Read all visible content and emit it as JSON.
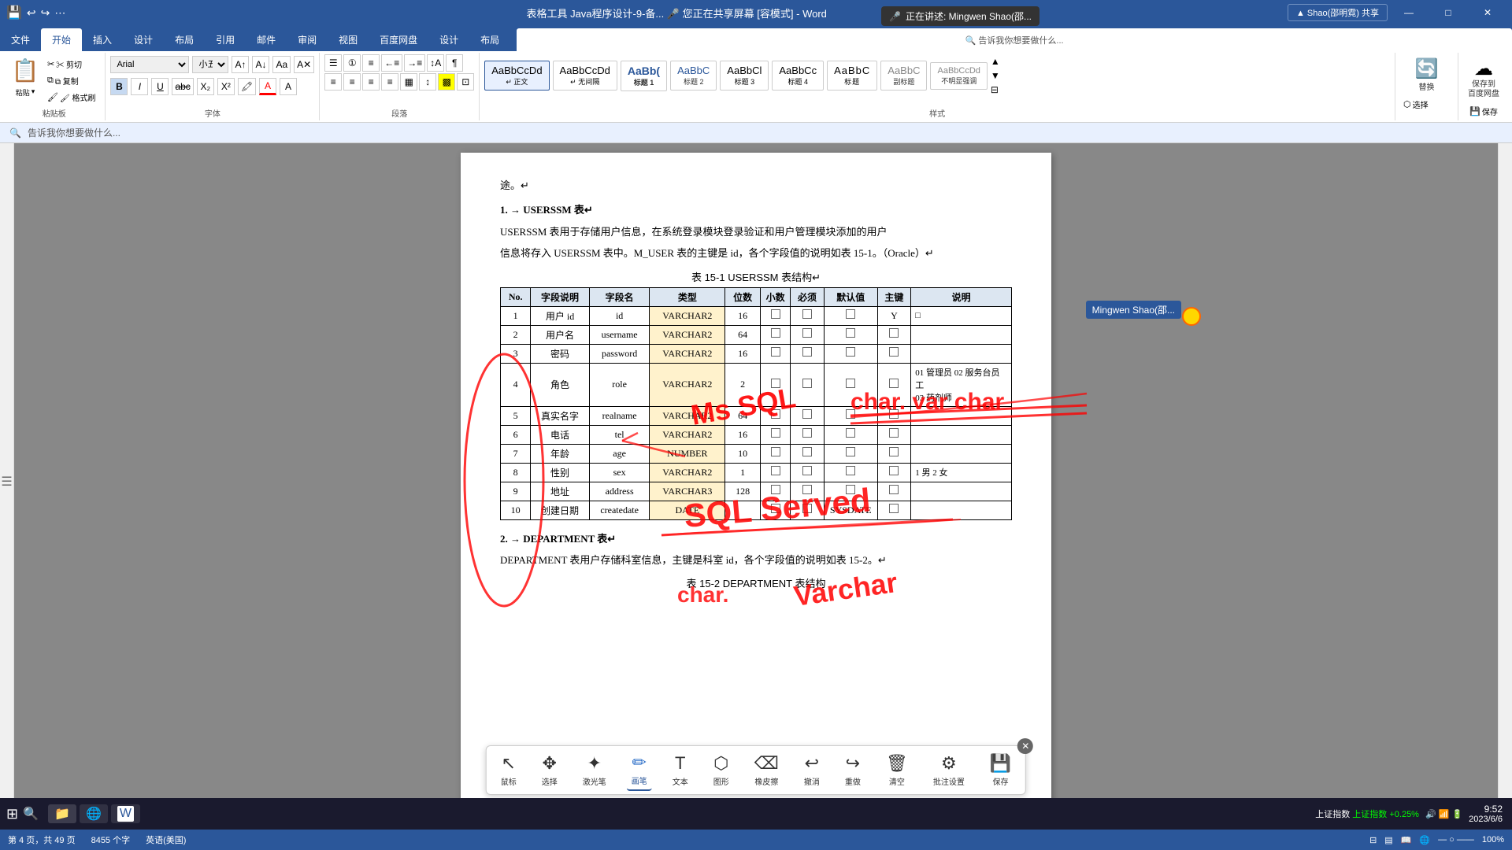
{
  "titlebar": {
    "left_icons": [
      "💾",
      "↩",
      "↪",
      "⋯"
    ],
    "center": "表格工具    Java程序设计-9-备...    🎤 您正在共享屏幕    [容模式] - Word",
    "right": "▲ Shao(邵明霓)   共享",
    "min": "—",
    "max": "□",
    "close": "✕"
  },
  "ribbon": {
    "tabs": [
      "文件",
      "开始",
      "插入",
      "设计",
      "布局",
      "引用",
      "邮件",
      "审阅",
      "视图",
      "百度网盘",
      "设计",
      "布局"
    ],
    "active_tab": "开始",
    "tell_me": "告诉我你想要做什么...",
    "clipboard": {
      "paste_label": "粘贴",
      "cut": "✂ 剪切",
      "copy": "⧉ 复制",
      "format_copy": "🖌 格式刷"
    },
    "font": {
      "face": "Arial",
      "size": "小五",
      "bold": "B",
      "italic": "I",
      "underline": "U",
      "strikethrough": "abc",
      "subscript": "X₂",
      "superscript": "X²"
    },
    "paragraph_label": "段落",
    "font_label": "字体",
    "styles_label": "样式",
    "styles": [
      {
        "label": "AaBbCcDd",
        "name": "正文",
        "active": true
      },
      {
        "label": "AaBbCcDd",
        "name": "无间隔"
      },
      {
        "label": "AaBb(",
        "name": "标题 1"
      },
      {
        "label": "AaBbC",
        "name": "标题 2"
      },
      {
        "label": "AaBbCl",
        "name": "标题 3"
      },
      {
        "label": "AaBbCc",
        "name": "标题 4"
      },
      {
        "label": "AaBbC",
        "name": "标题"
      },
      {
        "label": "AaBbC",
        "name": "副标题"
      },
      {
        "label": "AaBbCcDd",
        "name": "不明显强调"
      },
      {
        "label": "AaBbCcDd",
        "name": ""
      }
    ],
    "editing": {
      "replace": "替换",
      "select": "选择"
    },
    "save": {
      "label": "保存到\n百度网盘",
      "label2": "保存"
    }
  },
  "recording": {
    "text": "正在讲述: Mingwen Shao(邵..."
  },
  "document": {
    "path_note": "途。↵",
    "section1_num": "1.",
    "section1_title": "→ USERSSM 表↵",
    "para1": "USERSSM 表用于存储用户信息，在系统登录模块登录验证和用户管理模块添加的用户",
    "para2": "信息将存入 USERSSM 表中。M_USER 表的主键是 id，各个字段值的说明如表 15-1。（Oracle）↵",
    "table_title": "表 15-1 USERSSM 表结构↵",
    "table": {
      "headers": [
        "No.",
        "字段说明",
        "字段名",
        "类型",
        "位数",
        "小数",
        "必须",
        "默认值",
        "主键",
        "说明"
      ],
      "rows": [
        {
          "no": "1",
          "desc": "用户 id",
          "name": "id",
          "type": "VARCHAR2",
          "len": "16",
          "dec": "□",
          "req": "□",
          "def": "□",
          "pk": "Y",
          "note": "□"
        },
        {
          "no": "2",
          "desc": "用户名",
          "name": "username",
          "type": "VARCHAR2",
          "len": "64",
          "dec": "□□",
          "req": "□",
          "def": "□",
          "pk": "□",
          "note": ""
        },
        {
          "no": "3",
          "desc": "密码",
          "name": "password",
          "type": "VARCHAR2",
          "len": "16",
          "dec": "□□",
          "req": "□",
          "def": "□",
          "pk": "□",
          "note": ""
        },
        {
          "no": "4",
          "desc": "角色",
          "name": "role",
          "type": "VARCHAR2",
          "len": "2",
          "dec": "□□",
          "req": "□",
          "def": "□",
          "pk": "□",
          "note": "01 管理员 02 服务台员工\n03 药剂师"
        },
        {
          "no": "5",
          "desc": "真实名字",
          "name": "realname",
          "type": "VARCHAR2",
          "len": "64",
          "dec": "□□",
          "req": "□",
          "def": "□",
          "pk": "□",
          "note": ""
        },
        {
          "no": "6",
          "desc": "电话",
          "name": "tel",
          "type": "VARCHAR2",
          "len": "16",
          "dec": "□□",
          "req": "□",
          "def": "□",
          "pk": "□",
          "note": ""
        },
        {
          "no": "7",
          "desc": "年龄",
          "name": "age",
          "type": "NUMBER",
          "len": "10",
          "dec": "□□",
          "req": "□",
          "def": "□",
          "pk": "□",
          "note": ""
        },
        {
          "no": "8",
          "desc": "性别",
          "name": "sex",
          "type": "VARCHAR2",
          "len": "1",
          "dec": "□□",
          "req": "□",
          "def": "□",
          "pk": "□",
          "note": "1 男 2 女"
        },
        {
          "no": "9",
          "desc": "地址",
          "name": "address",
          "type": "VARCHAR3",
          "len": "128",
          "dec": "□□",
          "req": "□",
          "def": "□",
          "pk": "□",
          "note": ""
        },
        {
          "no": "10",
          "desc": "创建日期",
          "name": "createdate",
          "type": "DATE",
          "len": "",
          "dec": "□□",
          "req": "□",
          "def": "SYSDATE",
          "pk": "□",
          "note": ""
        }
      ]
    },
    "section2_num": "2.",
    "section2_title": "→ DEPARTMENT 表↵",
    "para3": "DEPARTMENT 表用户存储科室信息，主键是科室 id，各个字段值的说明如表 15-2。↵",
    "table2_title": "表 15-2 DEPARTMENT 表结构"
  },
  "draw_toolbar": {
    "items": [
      {
        "icon": "↖",
        "label": "鼠标"
      },
      {
        "icon": "✥",
        "label": "选择"
      },
      {
        "icon": "✦",
        "label": "激光笔"
      },
      {
        "icon": "✏",
        "label": "画笔",
        "active": true
      },
      {
        "icon": "T",
        "label": "文本"
      },
      {
        "icon": "⬡",
        "label": "图形"
      },
      {
        "icon": "⌦",
        "label": "橡皮擦"
      },
      {
        "icon": "↩",
        "label": "撤消"
      },
      {
        "icon": "↪",
        "label": "重做"
      },
      {
        "icon": "🗑",
        "label": "清空"
      },
      {
        "icon": "⚙",
        "label": "批注设置"
      },
      {
        "icon": "💾",
        "label": "保存"
      }
    ],
    "close": "✕"
  },
  "status_bar": {
    "page": "第 4 页，共 49 页",
    "words": "8455 个字",
    "lang": "英语(美国)",
    "zoom": "100%"
  },
  "presenter": {
    "name": "Mingwen Shao(邵..."
  },
  "taskbar": {
    "time": "9:52",
    "date": "2023/6/6",
    "system_tray": "上证指数 +0.25%"
  }
}
